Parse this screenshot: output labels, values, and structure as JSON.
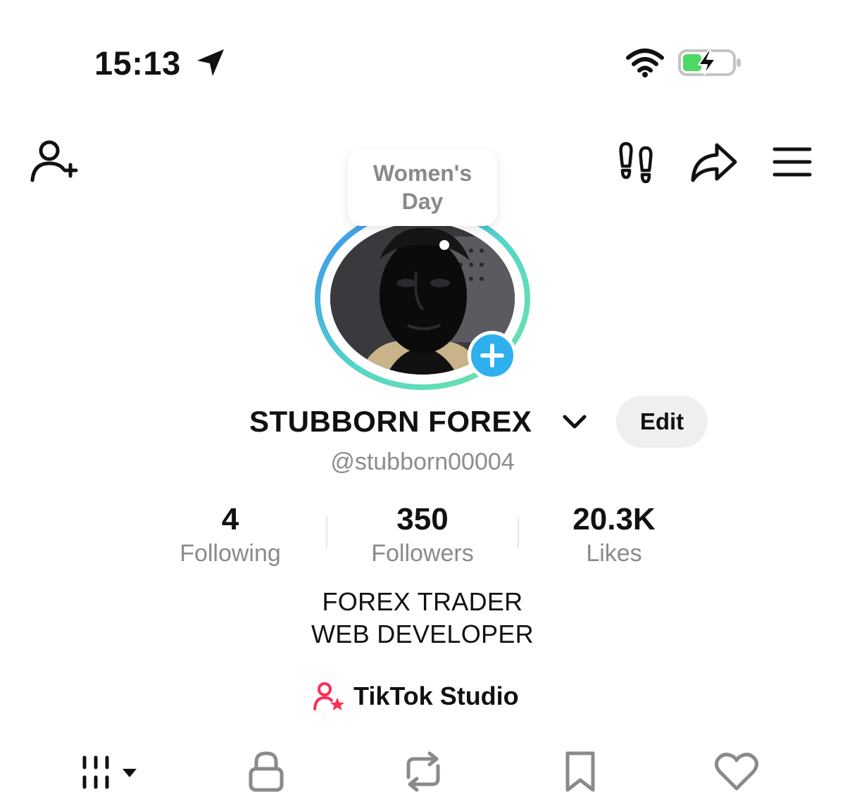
{
  "status_bar": {
    "time": "15:13",
    "icons": [
      "location-arrow-icon",
      "wifi-icon",
      "battery-charging-icon"
    ],
    "battery_color": "#4cd964"
  },
  "top_bar": {
    "icons": [
      "add-friend-icon",
      "footprints-icon",
      "share-icon",
      "menu-icon"
    ]
  },
  "avatar": {
    "bubble_text": "Women's Day",
    "ring_gradient": [
      "#3a8ff0",
      "#55d6c8",
      "#6fe3a6"
    ],
    "add_button_color": "#2eb0ee"
  },
  "profile": {
    "display_name": "STUBBORN FOREX",
    "edit_label": "Edit",
    "username": "@stubborn00004"
  },
  "stats": {
    "following": {
      "value": "4",
      "label": "Following"
    },
    "followers": {
      "value": "350",
      "label": "Followers"
    },
    "likes": {
      "value": "20.3K",
      "label": "Likes"
    }
  },
  "bio": {
    "line1": "FOREX TRADER",
    "line2": "WEB DEVELOPER"
  },
  "studio": {
    "label": "TikTok Studio",
    "icon_color": "#fe2c55"
  },
  "tabs": [
    "grid-icon",
    "lock-icon",
    "repost-icon",
    "bookmark-icon",
    "heart-icon"
  ]
}
